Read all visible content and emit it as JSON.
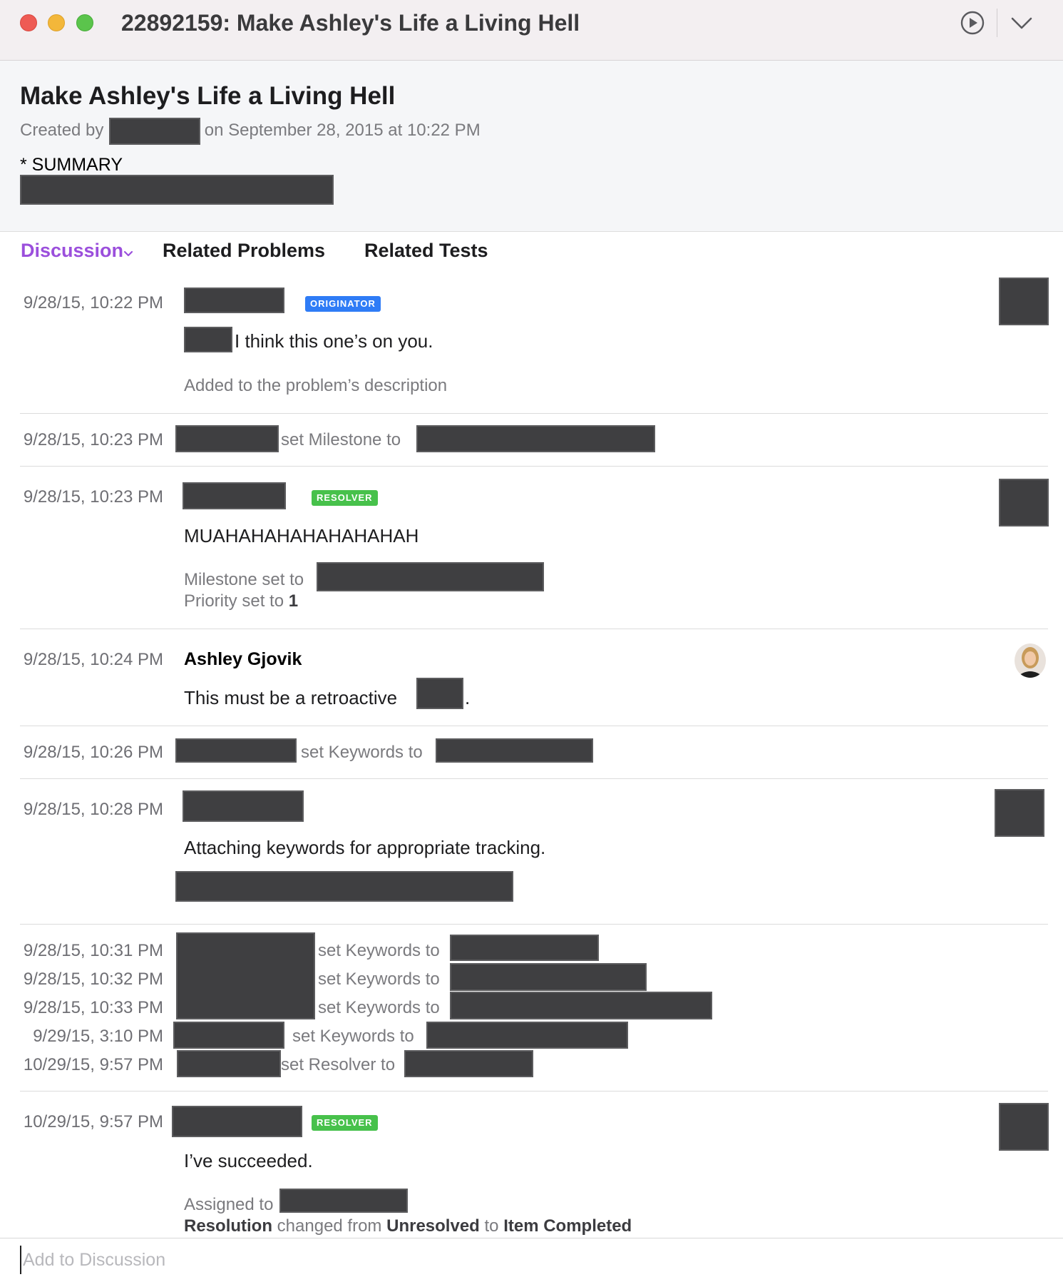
{
  "window": {
    "title": "22892159: Make Ashley's Life a Living Hell"
  },
  "toolbar": {
    "play_icon": "play-circle-icon",
    "menu_icon": "chevron-down-icon"
  },
  "header": {
    "title": "Make Ashley's Life a Living Hell",
    "created_prefix": "Created by",
    "created_suffix": "on September 28, 2015 at 10:22 PM",
    "summary_label": "* SUMMARY"
  },
  "tabs": [
    {
      "label": "Discussion",
      "active": true
    },
    {
      "label": "Related Problems",
      "active": false
    },
    {
      "label": "Related Tests",
      "active": false
    }
  ],
  "entries": {
    "e1": {
      "time": "9/28/15, 10:22 PM",
      "badge": "ORIGINATOR",
      "body": "I think this one’s on you.",
      "meta": "Added to the problem’s description"
    },
    "e2": {
      "time": "9/28/15, 10:23 PM",
      "action": "set Milestone to"
    },
    "e3": {
      "time": "9/28/15, 10:23 PM",
      "badge": "RESOLVER",
      "body": "MUAHAHAHAHAHAHAHAH",
      "meta1": "Milestone set to",
      "meta2_prefix": "Priority set to",
      "meta2_value": "1"
    },
    "e4": {
      "time": "9/28/15, 10:24 PM",
      "author": "Ashley Gjovik",
      "body": "This must be a retroactive",
      "body_end": "."
    },
    "e5": {
      "time": "9/28/15, 10:26 PM",
      "action": "set Keywords to"
    },
    "e6": {
      "time": "9/28/15, 10:28 PM",
      "body": "Attaching keywords for appropriate tracking."
    },
    "e7": [
      {
        "time": "9/28/15, 10:31 PM",
        "action": "set Keywords to"
      },
      {
        "time": "9/28/15, 10:32 PM",
        "action": "set Keywords to"
      },
      {
        "time": "9/28/15, 10:33 PM",
        "action": "set Keywords to"
      },
      {
        "time": "9/29/15, 3:10 PM",
        "action": "set Keywords to"
      },
      {
        "time": "10/29/15, 9:57 PM",
        "action": "set Resolver to"
      }
    ],
    "e8": {
      "time": "10/29/15, 9:57 PM",
      "badge": "RESOLVER",
      "body": "I’ve succeeded.",
      "meta1": "Assigned to",
      "res_label": "Resolution",
      "res_mid": "changed from",
      "res_from": "Unresolved",
      "res_to_word": "to",
      "res_to": "Item Completed"
    }
  },
  "composer": {
    "placeholder": "Add to Discussion"
  },
  "colors": {
    "accent": "#9b4fdc",
    "originator_badge": "#2f7cf6",
    "resolver_badge": "#47c14b",
    "redaction": "#3f3f41"
  }
}
